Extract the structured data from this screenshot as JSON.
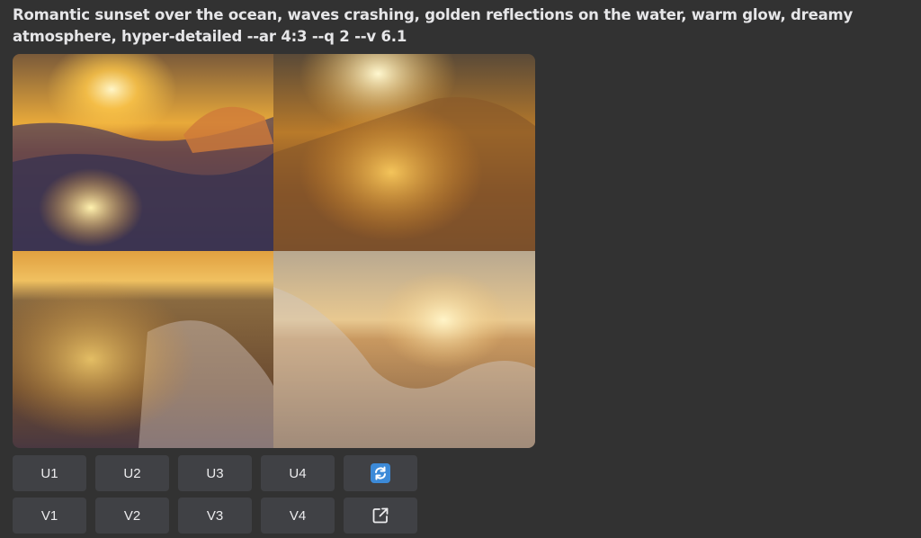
{
  "message": {
    "prompt": "Romantic sunset over the ocean, waves crashing, golden reflections on the water, warm glow, dreamy atmosphere, hyper-detailed --ar 4:3 --q 2 --v 6.1"
  },
  "image_grid": {
    "images": [
      {
        "description_icon": "sunset-ocean-wave-image-1"
      },
      {
        "description_icon": "sunset-ocean-wave-image-2"
      },
      {
        "description_icon": "sunset-ocean-wave-image-3"
      },
      {
        "description_icon": "sunset-ocean-wave-image-4"
      }
    ]
  },
  "buttons": {
    "upscale": [
      "U1",
      "U2",
      "U3",
      "U4"
    ],
    "variation": [
      "V1",
      "V2",
      "V3",
      "V4"
    ],
    "reroll_icon": "refresh-icon",
    "reroll_color": "#3c8ad8",
    "web_icon": "external-link-icon"
  },
  "colors": {
    "background": "#323232",
    "button": "#404145",
    "text": "#e6e6e8"
  }
}
